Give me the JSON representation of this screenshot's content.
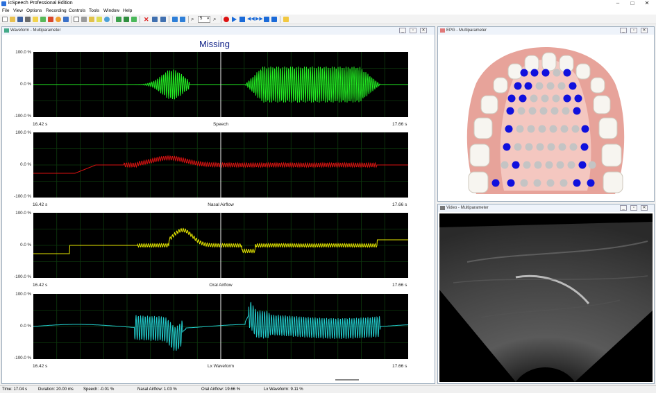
{
  "app": {
    "title": "icSpeech Professional Edition"
  },
  "menu": [
    "File",
    "View",
    "Options",
    "Recording",
    "Controls",
    "Tools",
    "Window",
    "Help"
  ],
  "toolbar": {
    "zoom_value": "5"
  },
  "waveform_window": {
    "title": "Waveform - Multiparameter",
    "heading": "Missing",
    "charts": [
      {
        "label": "Speech",
        "y_top": "100.0 %",
        "y_mid": "0.0 %",
        "y_bot": "-100.0 %",
        "t_start": "16.42 s",
        "t_end": "17.66 s",
        "color": "#22ee22"
      },
      {
        "label": "Nasal Airflow",
        "y_top": "100.0 %",
        "y_mid": "0.0 %",
        "y_bot": "-100.0 %",
        "t_start": "16.42 s",
        "t_end": "17.66 s",
        "color": "#dd1111"
      },
      {
        "label": "Oral Airflow",
        "y_top": "100.0 %",
        "y_mid": "0.0 %",
        "y_bot": "-100.0 %",
        "t_start": "16.42 s",
        "t_end": "17.66 s",
        "color": "#e6e600"
      },
      {
        "label": "Lx Waveform",
        "y_top": "100.0 %",
        "y_mid": "0.0 %",
        "y_bot": "-100.0 %",
        "t_start": "16.42 s",
        "t_end": "17.66 s",
        "color": "#22cccc"
      }
    ]
  },
  "epg_window": {
    "title": "EPG - Multiparameter",
    "active_color": "#1010dd",
    "inactive_color": "#c4c4c4"
  },
  "video_window": {
    "title": "Video - Multiparameter"
  },
  "status": {
    "time": "Time: 17.04 s",
    "duration": "Duration: 20.00 ms",
    "speech": "Speech: -0.01 %",
    "nasal": "Nasal Airflow: 1.03 %",
    "oral": "Oral Airflow: 19.66 %",
    "lx": "Lx Waveform: 9.11 %"
  }
}
